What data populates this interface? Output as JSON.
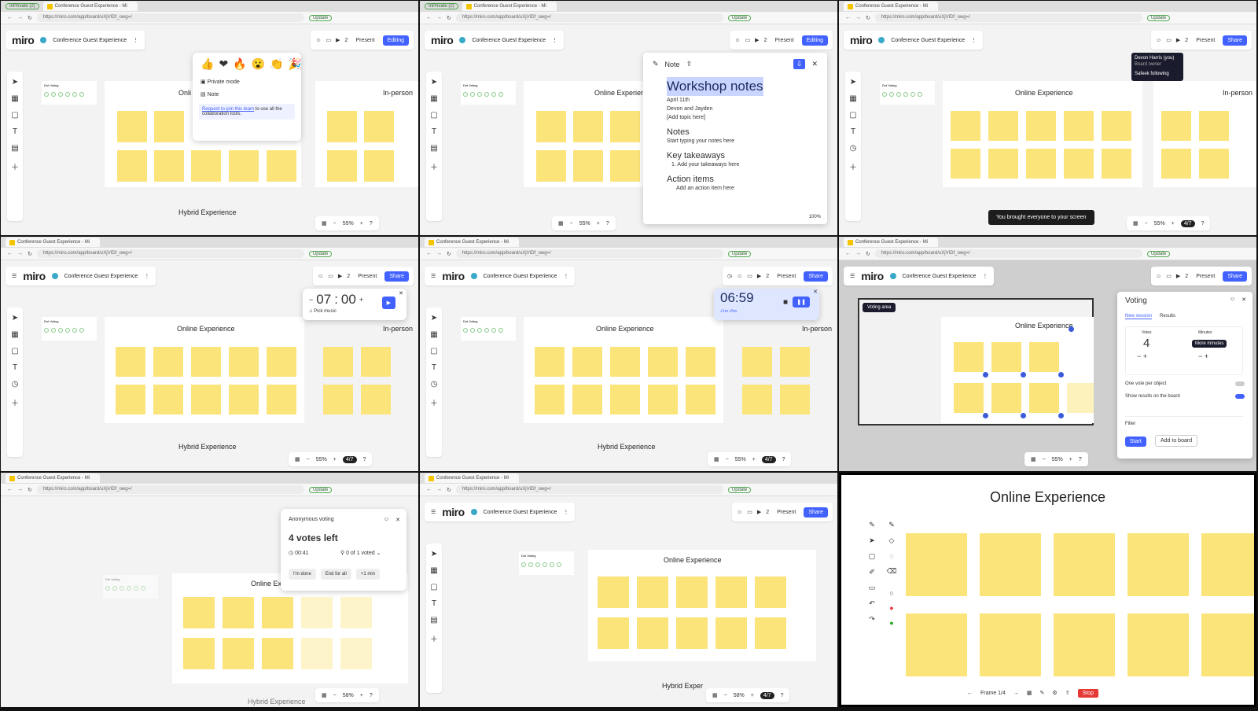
{
  "browser": {
    "tab_title": "Conference Guest Experience - Mi",
    "url": "https://miro.com/app/board/uXjVIDf_owg=/",
    "update_label": "Update",
    "inprivate": "InPrivate (2)"
  },
  "miro": {
    "logo": "miro",
    "board_name": "Conference Guest Experience",
    "present": "Present",
    "editing": "Editing",
    "share": "Share",
    "zoom": "55%",
    "zoom58": "58%",
    "user_count": "2",
    "frames": {
      "online": "Online Experience",
      "inperson": "In-person",
      "hybrid": "Hybrid Experience",
      "online_short": "Onli",
      "online_ex": "Online Ex",
      "hybrid_exper": "Hybrid Exper"
    },
    "dot_voting": "Dot Voting",
    "participants": "4/7"
  },
  "p1": {
    "private_mode": "Private mode",
    "note": "Note",
    "request_link": "Request to join this team",
    "request_rest": "to use all the collaboration tools."
  },
  "p2": {
    "note_label": "Note",
    "title": "Workshop notes",
    "date": "April 11th",
    "people": "Devon and Jayden",
    "topic": "[Add topic here]",
    "notes_h": "Notes",
    "notes_p": "Start typing your notes here",
    "key_h": "Key takeaways",
    "key_p": "1.  Add your takeaways here",
    "action_h": "Action items",
    "action_p": "Add an action item here",
    "zoom": "100%"
  },
  "p3": {
    "user": "Devon Harris (you)",
    "role": "Board owner",
    "following": "Safeek following",
    "toast": "You brought everyone to your screen"
  },
  "p4": {
    "minutes": "07",
    "seconds": "00",
    "pick_music": "Pick music"
  },
  "p5": {
    "time": "06:59",
    "plus1": "+1m",
    "plus5": "+5m"
  },
  "p6": {
    "voting_area": "Voting area",
    "title": "Voting",
    "tab_new": "New session",
    "tab_results": "Results",
    "votes_label": "Votes",
    "votes": "4",
    "minutes_label": "Minutes",
    "more_minutes": "More minutes",
    "one_vote": "One vote per object",
    "show_results": "Show results on the board",
    "filter": "Filter",
    "start": "Start",
    "add_board": "Add to board"
  },
  "p7": {
    "title": "Anonymous voting",
    "votes_left": "4 votes left",
    "timer": "00:41",
    "voted": "0 of 1 voted",
    "im_done": "I'm done",
    "end_all": "End for all",
    "plus1": "+1 min"
  },
  "p9": {
    "title": "Online Experience",
    "frame": "Frame 1/4",
    "stop": "Stop"
  }
}
